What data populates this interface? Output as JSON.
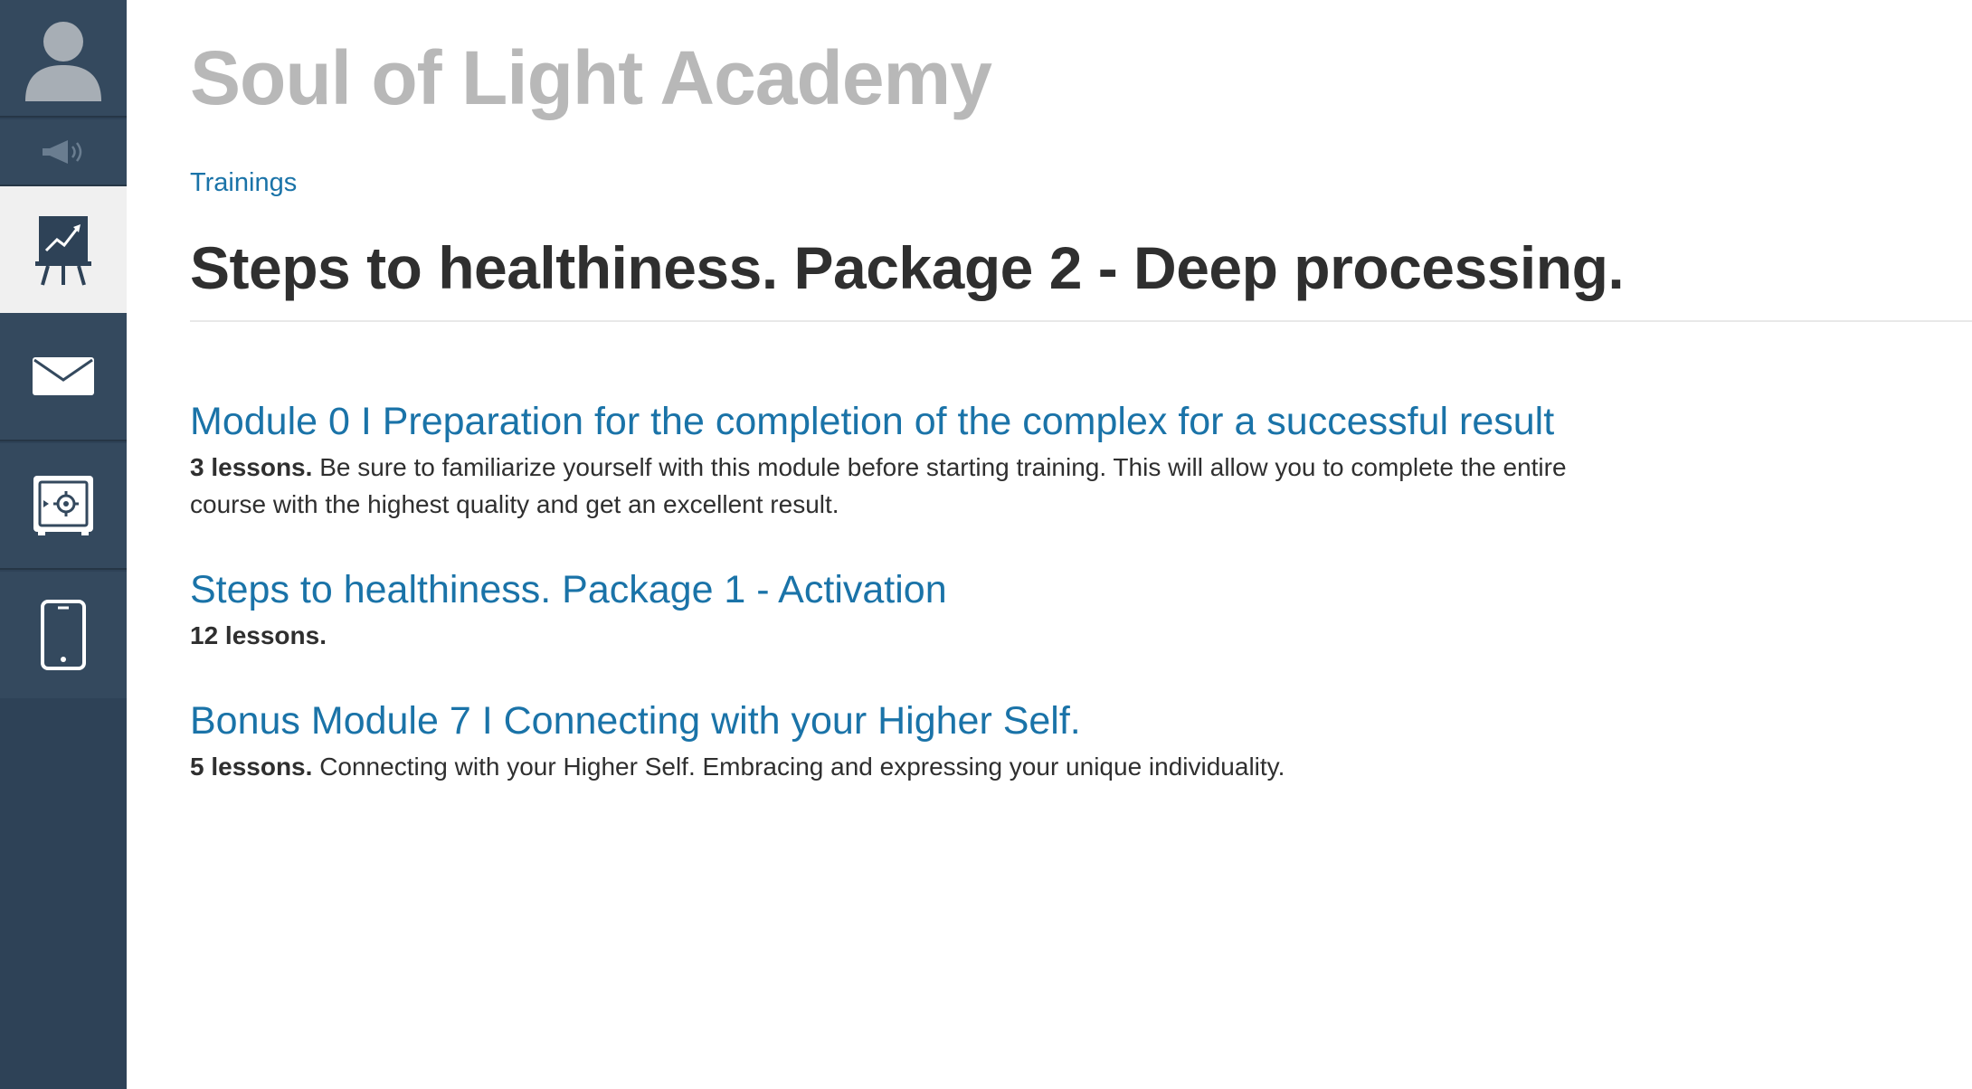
{
  "sidebar": {
    "items": [
      {
        "icon": "user-avatar-icon",
        "active": false
      },
      {
        "icon": "megaphone-icon",
        "active": false
      },
      {
        "icon": "trainings-chart-icon",
        "active": true
      },
      {
        "icon": "mail-icon",
        "active": false
      },
      {
        "icon": "safe-icon",
        "active": false
      },
      {
        "icon": "phone-icon",
        "active": false
      }
    ]
  },
  "header": {
    "site_title": "Soul of Light Academy"
  },
  "breadcrumb": {
    "label": "Trainings"
  },
  "page": {
    "title": "Steps to healthiness. Package 2 - Deep processing."
  },
  "modules": [
    {
      "title": "Module 0 I Preparation for the completion of the complex for a successful result",
      "lessons": "3 lessons.",
      "description": "Be sure to familiarize yourself with this module before starting training. This will allow you to complete the entire course with the highest quality and get an excellent result."
    },
    {
      "title": "Steps to healthiness. Package 1 - Activation",
      "lessons": "12 lessons.",
      "description": ""
    },
    {
      "title": "Bonus Module 7 I Connecting with your Higher Self.",
      "lessons": "5 lessons.",
      "description": "Connecting with your Higher Self. Embracing and expressing your unique individuality."
    }
  ],
  "colors": {
    "sidebar_bg": "#2e4257",
    "link": "#1a73a8",
    "site_title": "#b8b8b8",
    "text": "#2f2f2f"
  }
}
